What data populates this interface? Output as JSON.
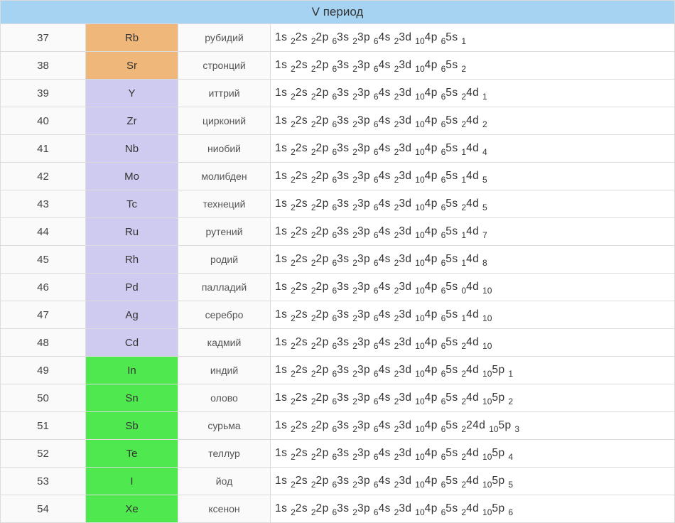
{
  "header": {
    "title": "V период"
  },
  "colors": {
    "orange": "#f0b77a",
    "violet": "#cfcaef",
    "green": "#4fe84f",
    "header": "#a7d3f2"
  },
  "chart_data": {
    "type": "table",
    "title": "V период",
    "columns": [
      "atomic_number",
      "symbol",
      "name_ru",
      "electron_configuration",
      "group_color"
    ],
    "rows": [
      {
        "atomic_number": 37,
        "symbol": "Rb",
        "name_ru": "рубидий",
        "group_color": "orange",
        "electron_configuration": [
          [
            "1s",
            2
          ],
          [
            "2s",
            2
          ],
          [
            "2p",
            6
          ],
          [
            "3s",
            2
          ],
          [
            "3p",
            6
          ],
          [
            "4s",
            2
          ],
          [
            "3d",
            10
          ],
          [
            "4p",
            6
          ],
          [
            "5s",
            1
          ]
        ]
      },
      {
        "atomic_number": 38,
        "symbol": "Sr",
        "name_ru": "стронций",
        "group_color": "orange",
        "electron_configuration": [
          [
            "1s",
            2
          ],
          [
            "2s",
            2
          ],
          [
            "2p",
            6
          ],
          [
            "3s",
            2
          ],
          [
            "3p",
            6
          ],
          [
            "4s",
            2
          ],
          [
            "3d",
            10
          ],
          [
            "4p",
            6
          ],
          [
            "5s",
            2
          ]
        ]
      },
      {
        "atomic_number": 39,
        "symbol": "Y",
        "name_ru": "иттрий",
        "group_color": "violet",
        "electron_configuration": [
          [
            "1s",
            2
          ],
          [
            "2s",
            2
          ],
          [
            "2p",
            6
          ],
          [
            "3s",
            2
          ],
          [
            "3p",
            6
          ],
          [
            "4s",
            2
          ],
          [
            "3d",
            10
          ],
          [
            "4p",
            6
          ],
          [
            "5s",
            2
          ],
          [
            "4d",
            1
          ]
        ]
      },
      {
        "atomic_number": 40,
        "symbol": "Zr",
        "name_ru": "цирконий",
        "group_color": "violet",
        "electron_configuration": [
          [
            "1s",
            2
          ],
          [
            "2s",
            2
          ],
          [
            "2p",
            6
          ],
          [
            "3s",
            2
          ],
          [
            "3p",
            6
          ],
          [
            "4s",
            2
          ],
          [
            "3d",
            10
          ],
          [
            "4p",
            6
          ],
          [
            "5s",
            2
          ],
          [
            "4d",
            2
          ]
        ]
      },
      {
        "atomic_number": 41,
        "symbol": "Nb",
        "name_ru": "ниобий",
        "group_color": "violet",
        "electron_configuration": [
          [
            "1s",
            2
          ],
          [
            "2s",
            2
          ],
          [
            "2p",
            6
          ],
          [
            "3s",
            2
          ],
          [
            "3p",
            6
          ],
          [
            "4s",
            2
          ],
          [
            "3d",
            10
          ],
          [
            "4p",
            6
          ],
          [
            "5s",
            1
          ],
          [
            "4d",
            4
          ]
        ]
      },
      {
        "atomic_number": 42,
        "symbol": "Mo",
        "name_ru": "молибден",
        "group_color": "violet",
        "electron_configuration": [
          [
            "1s",
            2
          ],
          [
            "2s",
            2
          ],
          [
            "2p",
            6
          ],
          [
            "3s",
            2
          ],
          [
            "3p",
            6
          ],
          [
            "4s",
            2
          ],
          [
            "3d",
            10
          ],
          [
            "4p",
            6
          ],
          [
            "5s",
            1
          ],
          [
            "4d",
            5
          ]
        ]
      },
      {
        "atomic_number": 43,
        "symbol": "Tc",
        "name_ru": "технеций",
        "group_color": "violet",
        "electron_configuration": [
          [
            "1s",
            2
          ],
          [
            "2s",
            2
          ],
          [
            "2p",
            6
          ],
          [
            "3s",
            2
          ],
          [
            "3p",
            6
          ],
          [
            "4s",
            2
          ],
          [
            "3d",
            10
          ],
          [
            "4p",
            6
          ],
          [
            "5s",
            2
          ],
          [
            "4d",
            5
          ]
        ]
      },
      {
        "atomic_number": 44,
        "symbol": "Ru",
        "name_ru": "рутений",
        "group_color": "violet",
        "electron_configuration": [
          [
            "1s",
            2
          ],
          [
            "2s",
            2
          ],
          [
            "2p",
            6
          ],
          [
            "3s",
            2
          ],
          [
            "3p",
            6
          ],
          [
            "4s",
            2
          ],
          [
            "3d",
            10
          ],
          [
            "4p",
            6
          ],
          [
            "5s",
            1
          ],
          [
            "4d",
            7
          ]
        ]
      },
      {
        "atomic_number": 45,
        "symbol": "Rh",
        "name_ru": "родий",
        "group_color": "violet",
        "electron_configuration": [
          [
            "1s",
            2
          ],
          [
            "2s",
            2
          ],
          [
            "2p",
            6
          ],
          [
            "3s",
            2
          ],
          [
            "3p",
            6
          ],
          [
            "4s",
            2
          ],
          [
            "3d",
            10
          ],
          [
            "4p",
            6
          ],
          [
            "5s",
            1
          ],
          [
            "4d",
            8
          ]
        ]
      },
      {
        "atomic_number": 46,
        "symbol": "Pd",
        "name_ru": "палладий",
        "group_color": "violet",
        "electron_configuration": [
          [
            "1s",
            2
          ],
          [
            "2s",
            2
          ],
          [
            "2p",
            6
          ],
          [
            "3s",
            2
          ],
          [
            "3p",
            6
          ],
          [
            "4s",
            2
          ],
          [
            "3d",
            10
          ],
          [
            "4p",
            6
          ],
          [
            "5s",
            0
          ],
          [
            "4d",
            10
          ]
        ]
      },
      {
        "atomic_number": 47,
        "symbol": "Ag",
        "name_ru": "серебро",
        "group_color": "violet",
        "electron_configuration": [
          [
            "1s",
            2
          ],
          [
            "2s",
            2
          ],
          [
            "2p",
            6
          ],
          [
            "3s",
            2
          ],
          [
            "3p",
            6
          ],
          [
            "4s",
            2
          ],
          [
            "3d",
            10
          ],
          [
            "4p",
            6
          ],
          [
            "5s",
            1
          ],
          [
            "4d",
            10
          ]
        ]
      },
      {
        "atomic_number": 48,
        "symbol": "Cd",
        "name_ru": "кадмий",
        "group_color": "violet",
        "electron_configuration": [
          [
            "1s",
            2
          ],
          [
            "2s",
            2
          ],
          [
            "2p",
            6
          ],
          [
            "3s",
            2
          ],
          [
            "3p",
            6
          ],
          [
            "4s",
            2
          ],
          [
            "3d",
            10
          ],
          [
            "4p",
            6
          ],
          [
            "5s",
            2
          ],
          [
            "4d",
            10
          ]
        ]
      },
      {
        "atomic_number": 49,
        "symbol": "In",
        "name_ru": "индий",
        "group_color": "green",
        "electron_configuration": [
          [
            "1s",
            2
          ],
          [
            "2s",
            2
          ],
          [
            "2p",
            6
          ],
          [
            "3s",
            2
          ],
          [
            "3p",
            6
          ],
          [
            "4s",
            2
          ],
          [
            "3d",
            10
          ],
          [
            "4p",
            6
          ],
          [
            "5s",
            2
          ],
          [
            "4d",
            10
          ],
          [
            "5p",
            1
          ]
        ]
      },
      {
        "atomic_number": 50,
        "symbol": "Sn",
        "name_ru": "олово",
        "group_color": "green",
        "electron_configuration": [
          [
            "1s",
            2
          ],
          [
            "2s",
            2
          ],
          [
            "2p",
            6
          ],
          [
            "3s",
            2
          ],
          [
            "3p",
            6
          ],
          [
            "4s",
            2
          ],
          [
            "3d",
            10
          ],
          [
            "4p",
            6
          ],
          [
            "5s",
            2
          ],
          [
            "4d",
            10
          ],
          [
            "5p",
            2
          ]
        ]
      },
      {
        "atomic_number": 51,
        "symbol": "Sb",
        "name_ru": "сурьма",
        "group_color": "green",
        "electron_configuration": [
          [
            "1s",
            2
          ],
          [
            "2s",
            2
          ],
          [
            "2p",
            6
          ],
          [
            "3s",
            2
          ],
          [
            "3p",
            6
          ],
          [
            "4s",
            2
          ],
          [
            "3d",
            10
          ],
          [
            "4p",
            6
          ],
          [
            "5s",
            2
          ],
          [
            "24d",
            10
          ],
          [
            "5p",
            3
          ]
        ]
      },
      {
        "atomic_number": 52,
        "symbol": "Te",
        "name_ru": "теллур",
        "group_color": "green",
        "electron_configuration": [
          [
            "1s",
            2
          ],
          [
            "2s",
            2
          ],
          [
            "2p",
            6
          ],
          [
            "3s",
            2
          ],
          [
            "3p",
            6
          ],
          [
            "4s",
            2
          ],
          [
            "3d",
            10
          ],
          [
            "4p",
            6
          ],
          [
            "5s",
            2
          ],
          [
            "4d",
            10
          ],
          [
            "5p",
            4
          ]
        ]
      },
      {
        "atomic_number": 53,
        "symbol": "I",
        "name_ru": "йод",
        "group_color": "green",
        "electron_configuration": [
          [
            "1s",
            2
          ],
          [
            "2s",
            2
          ],
          [
            "2p",
            6
          ],
          [
            "3s",
            2
          ],
          [
            "3p",
            6
          ],
          [
            "4s",
            2
          ],
          [
            "3d",
            10
          ],
          [
            "4p",
            6
          ],
          [
            "5s",
            2
          ],
          [
            "4d",
            10
          ],
          [
            "5p",
            5
          ]
        ]
      },
      {
        "atomic_number": 54,
        "symbol": "Xe",
        "name_ru": "ксенон",
        "group_color": "green",
        "electron_configuration": [
          [
            "1s",
            2
          ],
          [
            "2s",
            2
          ],
          [
            "2p",
            6
          ],
          [
            "3s",
            2
          ],
          [
            "3p",
            6
          ],
          [
            "4s",
            2
          ],
          [
            "3d",
            10
          ],
          [
            "4p",
            6
          ],
          [
            "5s",
            2
          ],
          [
            "4d",
            10
          ],
          [
            "5p",
            6
          ]
        ]
      }
    ]
  }
}
